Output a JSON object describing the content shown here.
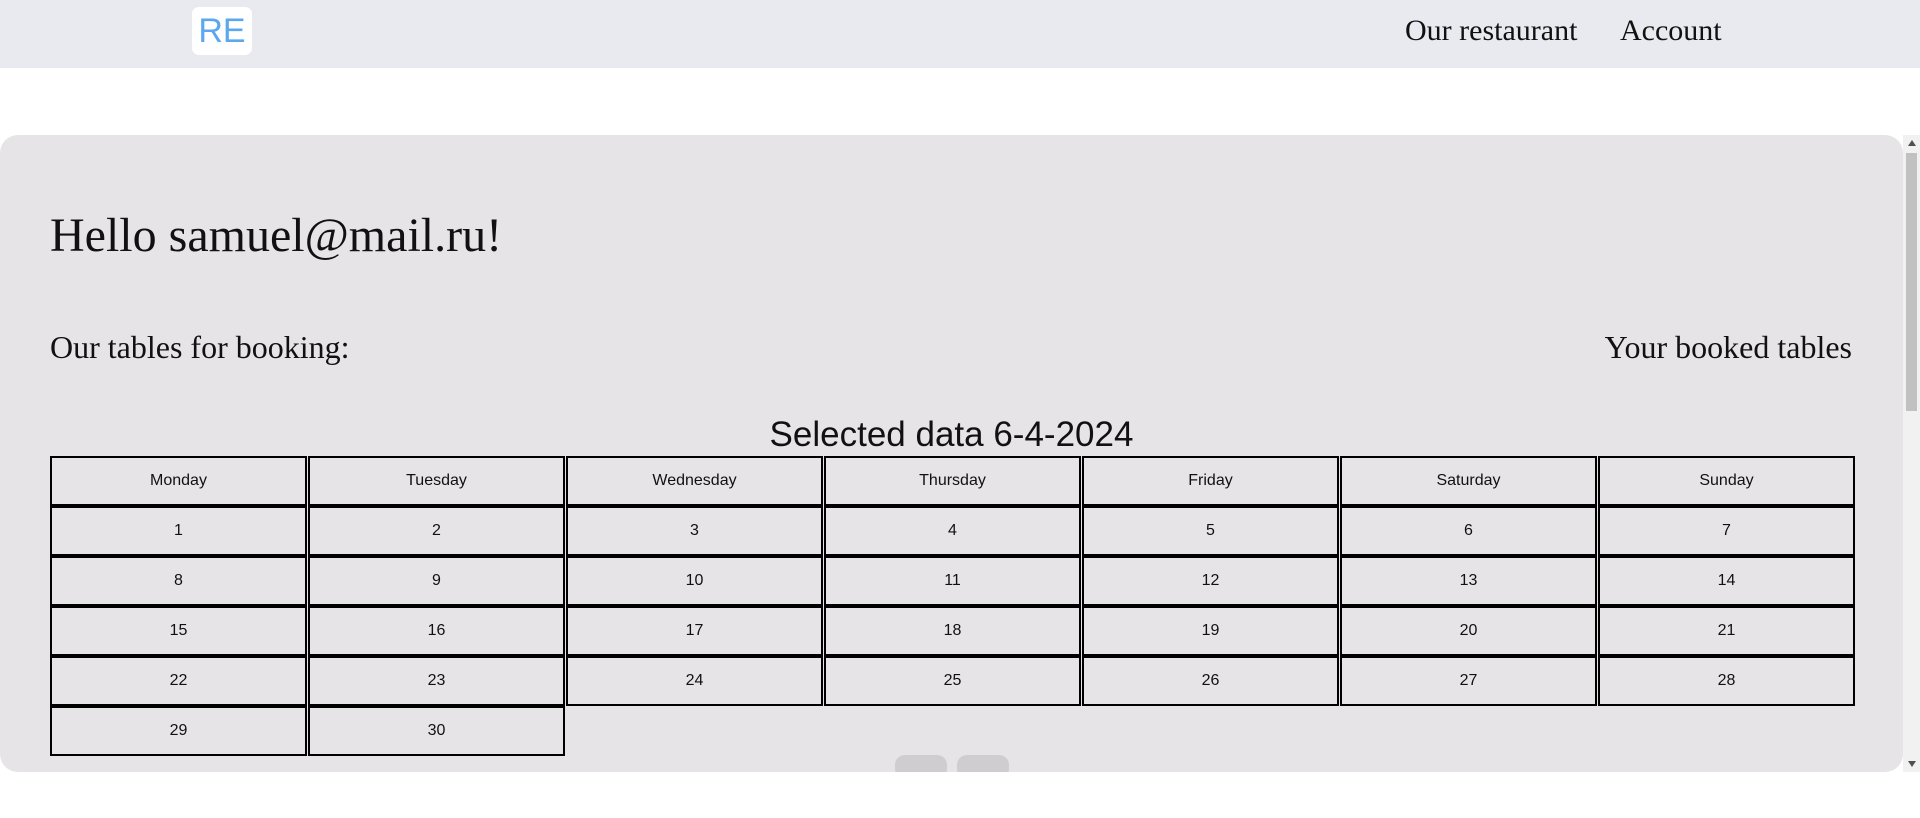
{
  "header": {
    "logo_text": "RE",
    "nav": [
      "Our restaurant",
      "Account"
    ]
  },
  "main": {
    "greeting": "Hello samuel@mail.ru!",
    "tables_label": "Our tables for booking:",
    "booked_label": "Your booked tables",
    "selected_date": "Selected data 6-4-2024"
  },
  "calendar": {
    "weekdays": [
      "Monday",
      "Tuesday",
      "Wednesday",
      "Thursday",
      "Friday",
      "Saturday",
      "Sunday"
    ],
    "days": [
      "1",
      "2",
      "3",
      "4",
      "5",
      "6",
      "7",
      "8",
      "9",
      "10",
      "11",
      "12",
      "13",
      "14",
      "15",
      "16",
      "17",
      "18",
      "19",
      "20",
      "21",
      "22",
      "23",
      "24",
      "25",
      "26",
      "27",
      "28",
      "29",
      "30"
    ]
  },
  "colors": {
    "topbar_bg": "#e9eaef",
    "panel_bg": "#e6e4e6",
    "logo_text": "#5ba8ee"
  },
  "icons": {
    "scroll_up": "triangle-up-icon",
    "scroll_down": "triangle-down-icon"
  }
}
